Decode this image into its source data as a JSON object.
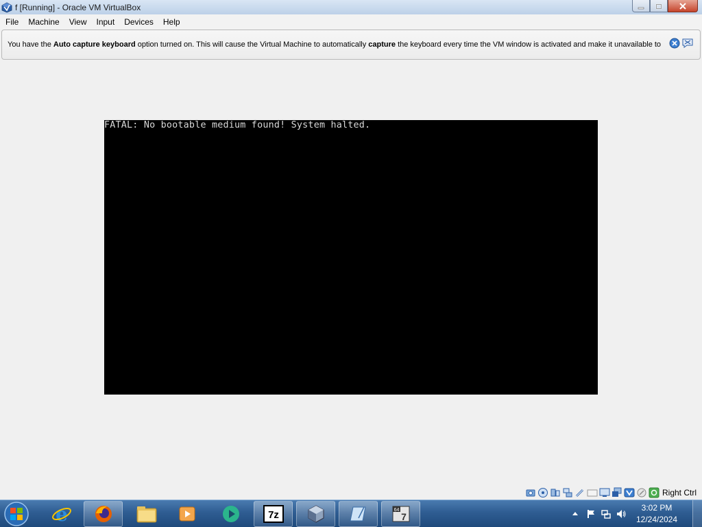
{
  "window": {
    "title": "f [Running] - Oracle VM VirtualBox",
    "icon": "virtualbox-icon",
    "controls": [
      "minimize",
      "restore",
      "close"
    ]
  },
  "menu": {
    "file": "File",
    "machine": "Machine",
    "view": "View",
    "input": "Input",
    "devices": "Devices",
    "help": "Help"
  },
  "notice": {
    "part1": "You have the ",
    "bold1": "Auto capture keyboard",
    "part2": " option turned on. This will cause the Virtual Machine to automatically ",
    "bold2": "capture",
    "part3": " the keyboard every time the VM window is activated and make it unavailable to"
  },
  "vm": {
    "screen_text": "FATAL: No bootable medium found! System halted."
  },
  "statusbar": {
    "icons": [
      "hard-disk-icon",
      "optical-disk-icon",
      "audio-icon",
      "network-icon",
      "usb-icon",
      "shared-folders-icon",
      "display-icon",
      "video-capture-icon",
      "virtualization-icon",
      "mouse-integration-icon",
      "keyboard-capture-icon"
    ],
    "host_key": "Right Ctrl"
  },
  "taskbar": {
    "apps": [
      "internet-explorer-icon",
      "firefox-icon",
      "file-explorer-icon",
      "media-player-icon",
      "app-icon",
      "7zip-icon",
      "virtualbox-icon",
      "notepad-icon",
      "virtualbox-running-icon"
    ],
    "clock": {
      "time": "3:02 PM",
      "date": "12/24/2024"
    }
  },
  "colors": {
    "taskbar": "#2f5d92",
    "vm_background": "#000000",
    "window_background": "#f0f0f0"
  }
}
